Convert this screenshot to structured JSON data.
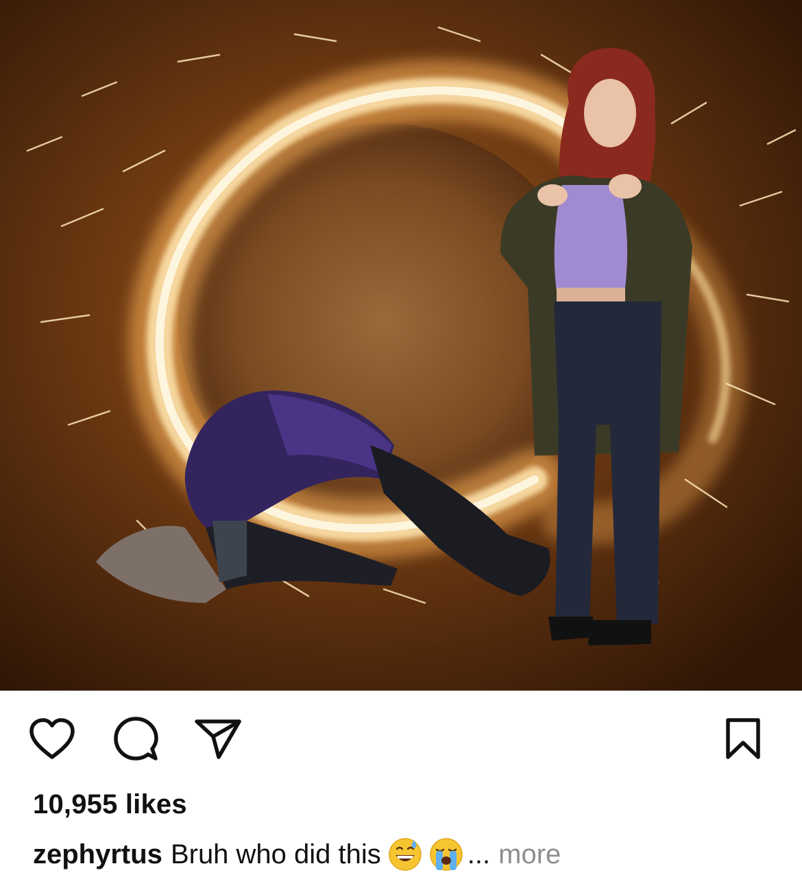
{
  "post": {
    "image": {
      "description_icon": "photo-post-image"
    },
    "actions": {
      "like_icon": "heart-icon",
      "comment_icon": "comment-icon",
      "share_icon": "paper-plane-icon",
      "save_icon": "bookmark-icon"
    },
    "likes_text": "10,955 likes",
    "caption": {
      "username": "zephyrtus",
      "text": "Bruh who did this",
      "emojis": [
        "grinning-sweat-emoji",
        "loudly-crying-emoji"
      ],
      "ellipsis": "...",
      "more_label": "more"
    }
  },
  "colors": {
    "text": "#111111",
    "muted": "#8e8e8e",
    "background": "#ffffff"
  }
}
